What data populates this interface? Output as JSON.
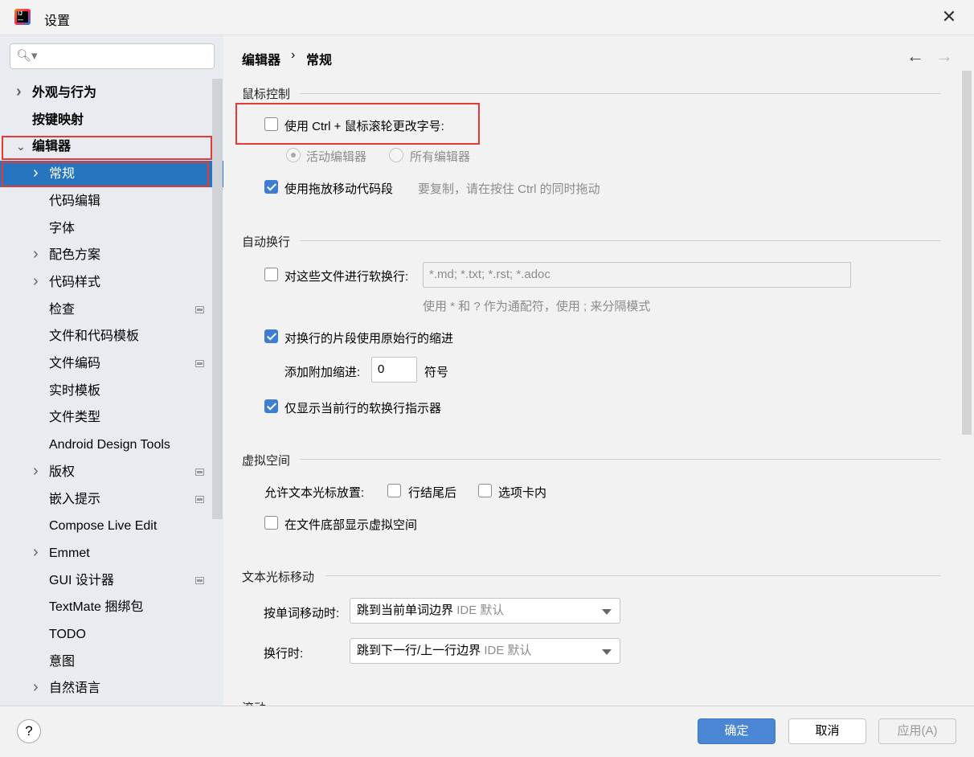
{
  "window": {
    "title": "设置",
    "close_icon": "close-icon"
  },
  "sidebar": {
    "search_placeholder": "",
    "items": [
      {
        "label": "外观与行为",
        "chevron": "right",
        "bold": true
      },
      {
        "label": "按键映射",
        "bold": true
      },
      {
        "label": "编辑器",
        "chevron": "down",
        "bold": true
      },
      {
        "label": "常规",
        "chevron": "right",
        "selected": true
      },
      {
        "label": "代码编辑"
      },
      {
        "label": "字体"
      },
      {
        "label": "配色方案",
        "chevron": "right"
      },
      {
        "label": "代码样式",
        "chevron": "right"
      },
      {
        "label": "检查",
        "badge": true
      },
      {
        "label": "文件和代码模板"
      },
      {
        "label": "文件编码",
        "badge": true
      },
      {
        "label": "实时模板"
      },
      {
        "label": "文件类型"
      },
      {
        "label": "Android Design Tools"
      },
      {
        "label": "版权",
        "chevron": "right",
        "badge": true
      },
      {
        "label": "嵌入提示",
        "badge": true
      },
      {
        "label": "Compose Live Edit"
      },
      {
        "label": "Emmet",
        "chevron": "right"
      },
      {
        "label": "GUI 设计器",
        "badge": true
      },
      {
        "label": "TextMate 捆绑包"
      },
      {
        "label": "TODO"
      },
      {
        "label": "意图"
      },
      {
        "label": "自然语言",
        "chevron": "right"
      }
    ]
  },
  "breadcrumb": {
    "parent": "编辑器",
    "separator": "›",
    "current": "常规"
  },
  "nav": {
    "back": "←",
    "forward": "→"
  },
  "sections": {
    "mouse": {
      "title": "鼠标控制",
      "ctrl_wheel": {
        "label": "使用 Ctrl + 鼠标滚轮更改字号:",
        "checked": false
      },
      "radio_active": {
        "label": "活动编辑器",
        "selected": true
      },
      "radio_all": {
        "label": "所有编辑器",
        "selected": false
      },
      "drag_drop": {
        "label": "使用拖放移动代码段",
        "checked": true,
        "hint": "要复制，请在按住 Ctrl 的同时拖动"
      }
    },
    "softwrap": {
      "title": "自动换行",
      "soft_wrap_files": {
        "label": "对这些文件进行软换行:",
        "checked": false,
        "value": "*.md; *.txt; *.rst; *.adoc",
        "hint": "使用 * 和 ? 作为通配符，使用 ; 来分隔模式"
      },
      "original_indent": {
        "label": "对换行的片段使用原始行的缩进",
        "checked": true
      },
      "extra_indent": {
        "label": "添加附加缩进:",
        "value": "0",
        "unit": "符号"
      },
      "current_line_only": {
        "label": "仅显示当前行的软换行指示器",
        "checked": true
      }
    },
    "virtual": {
      "title": "虚拟空间",
      "allow_label": "允许文本光标放置:",
      "end_of_line": {
        "label": "行结尾后",
        "checked": false
      },
      "inside_tabs": {
        "label": "选项卡内",
        "checked": false
      },
      "show_bottom": {
        "label": "在文件底部显示虚拟空间",
        "checked": false
      }
    },
    "caret": {
      "title": "文本光标移动",
      "word_move": {
        "label": "按单词移动时:",
        "value": "跳到当前单词边界",
        "default_hint": "IDE 默认"
      },
      "line_move": {
        "label": "换行时:",
        "value": "跳到下一行/上一行边界",
        "default_hint": "IDE 默认"
      }
    },
    "scroll": {
      "title": "滚动"
    }
  },
  "footer": {
    "help": "?",
    "ok": "确定",
    "cancel": "取消",
    "apply": "应用(A)"
  },
  "colors": {
    "selection": "#2675bf",
    "primary_button": "#4a86d4",
    "highlight_box": "#e53935",
    "checkbox_on": "#3d7ed4"
  }
}
